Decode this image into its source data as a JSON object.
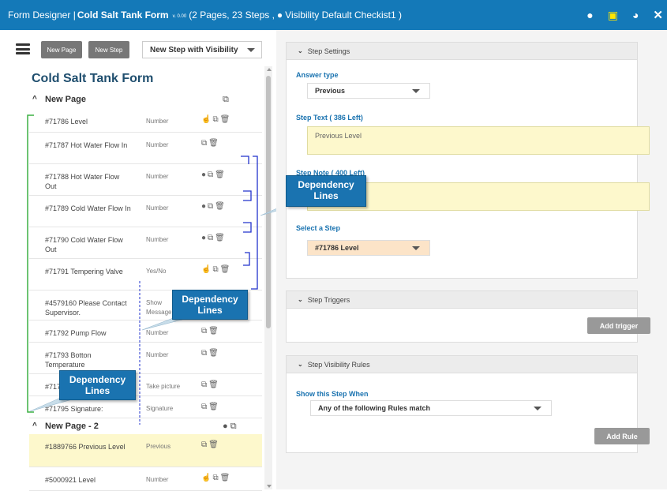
{
  "title_bar": {
    "prefix": "Form Designer | ",
    "form_name": "Cold Salt Tank Form",
    "version": "v. 0.00",
    "info": "(2 Pages, 23 Steps , ",
    "visibility_label": "Visibility Default Checkist1 )",
    "icons": [
      "eye-icon",
      "save-icon",
      "globe-icon",
      "close-icon"
    ]
  },
  "toolbar": {
    "new_page_label": "New Page",
    "new_step_label": "New Step",
    "step_type_value": "New Step with Visibility"
  },
  "form": {
    "title": "Cold Salt Tank Form",
    "pages": [
      {
        "label": "New Page",
        "steps": [
          {
            "name": "#71786 Level",
            "type": "Number"
          },
          {
            "name": "#71787 Hot Water Flow In",
            "type": "Number"
          },
          {
            "name": "#71788 Hot Water Flow Out",
            "type": "Number"
          },
          {
            "name": "#71789 Cold Water Flow In",
            "type": "Number"
          },
          {
            "name": "#71790 Cold Water Flow Out",
            "type": "Number"
          },
          {
            "name": "#71791 Tempering Valve",
            "type": "Yes/No"
          },
          {
            "name": "#4579160 Please Contact Supervisor.",
            "type": "Show Message"
          },
          {
            "name": "#71792 Pump Flow",
            "type": "Number"
          },
          {
            "name": "#71793 Botton Temperature",
            "type": "Number"
          },
          {
            "name": "#71794",
            "type": "Take picture"
          },
          {
            "name": "#71795 Signature:",
            "type": "Signature"
          }
        ]
      },
      {
        "label": "New Page - 2",
        "steps": [
          {
            "name": "#1889766 Previous Level",
            "type": "Previous"
          },
          {
            "name": "#5000921 Level",
            "type": "Number"
          }
        ]
      }
    ]
  },
  "callouts": [
    {
      "text": "Dependency Lines"
    },
    {
      "text": "Dependency Lines"
    },
    {
      "text": "Dependency Lines"
    }
  ],
  "step_settings": {
    "header": "Step Settings",
    "answer_type_label": "Answer type",
    "answer_type_value": "Previous",
    "step_text_label": "Step Text ( 386 Left)",
    "step_text_value": "Previous Level",
    "step_note_label": "Step Note ( 400 Left)",
    "select_step_label": "Select a Step",
    "select_step_value": "#71786 Level"
  },
  "step_triggers": {
    "header": "Step Triggers",
    "add_trigger_label": "Add trigger"
  },
  "step_visibility": {
    "header": "Step Visibility Rules",
    "show_when_label": "Show this Step When",
    "match_value": "Any of the following Rules match",
    "add_rule_label": "Add Rule"
  },
  "colors": {
    "title_bar": "#1479b8",
    "callout": "#1a73b0",
    "highlight_row": "#fdf8cc",
    "select_step_bg": "#fce4c8",
    "dependency_green": "#3cb043",
    "dependency_blue": "#2233cc"
  }
}
